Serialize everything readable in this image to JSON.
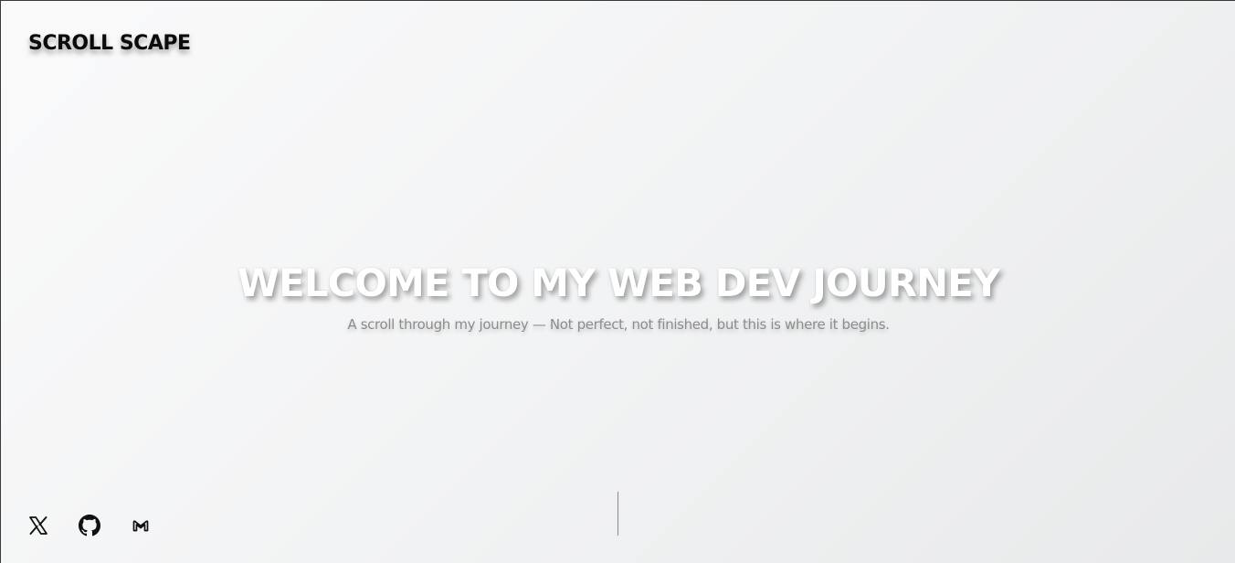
{
  "header": {
    "brand": "SCROLL SCAPE"
  },
  "hero": {
    "title": "WELCOME TO MY WEB DEV JOURNEY",
    "subtitle": "A scroll through my journey — Not perfect, not finished, but this is where it begins."
  },
  "socials": [
    {
      "icon": "x-icon"
    },
    {
      "icon": "github-icon"
    },
    {
      "icon": "mail-icon"
    }
  ],
  "colors": {
    "text": "#0b0b0b",
    "subtitle": "#8c8c8c",
    "hero_title": "#ffffff"
  }
}
